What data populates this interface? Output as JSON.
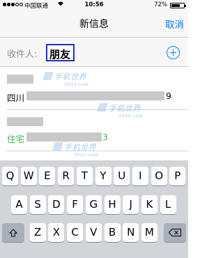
{
  "status_bar": {
    "carrier": "中国联通",
    "wifi_icon": "wifi-icon",
    "time": "10:56",
    "battery_percent": "72%",
    "battery_level": 0.72
  },
  "nav": {
    "title": "新信息",
    "cancel_label": "取消"
  },
  "recipient": {
    "label": "收件人:",
    "value": "朋友",
    "add_icon": "plus-circle-icon"
  },
  "results": [
    {
      "label": "四川",
      "tail": "9",
      "label_color": "#000000"
    },
    {
      "label": "住宅",
      "tail": "3",
      "label_color": "#3ab34a"
    }
  ],
  "watermark": {
    "text": "手机世界",
    "sub": "3533.com"
  },
  "keyboard": {
    "row1": [
      "Q",
      "W",
      "E",
      "R",
      "T",
      "Y",
      "U",
      "I",
      "O",
      "P"
    ],
    "row2": [
      "A",
      "S",
      "D",
      "F",
      "G",
      "H",
      "J",
      "K",
      "L"
    ],
    "row3": [
      "Z",
      "X",
      "C",
      "V",
      "B",
      "N",
      "M"
    ],
    "shift_icon": "shift-icon",
    "delete_icon": "delete-icon"
  }
}
